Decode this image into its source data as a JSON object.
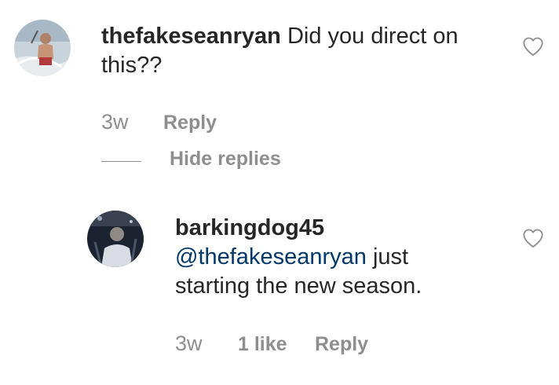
{
  "comment": {
    "username": "thefakeseanryan",
    "text": "Did you direct on this??",
    "time": "3w",
    "reply_label": "Reply",
    "hide_replies_label": "Hide replies"
  },
  "reply": {
    "username": "barkingdog45",
    "mention": "@thefakeseanryan",
    "text": "just starting the new season.",
    "time": "3w",
    "likes": "1 like",
    "reply_label": "Reply"
  },
  "icons": {
    "like": "heart-outline-icon"
  },
  "colors": {
    "text": "#262626",
    "secondary": "#8e8e8e",
    "mention": "#00376b"
  }
}
